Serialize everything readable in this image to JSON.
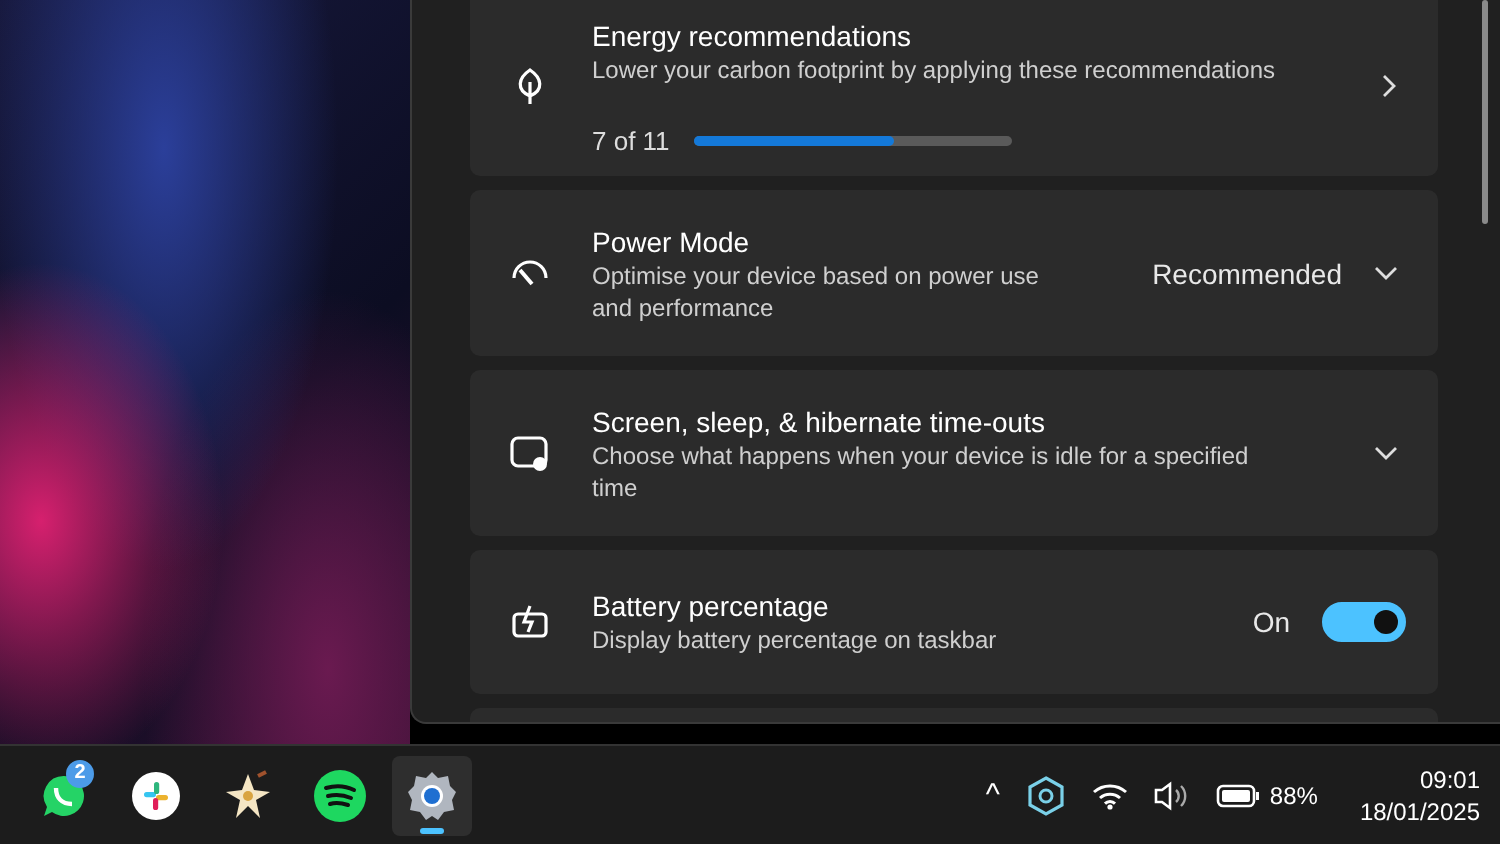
{
  "settings": {
    "cards": [
      {
        "kind": "progress",
        "title": "Energy recommendations",
        "description": "Lower your carbon footprint by applying these recommendations",
        "progress_label": "7 of 11",
        "level": 0.63
      },
      {
        "kind": "dropdown",
        "title": "Power Mode",
        "description": "Optimise your device based on power use and performance",
        "value": "Recommended"
      },
      {
        "kind": "expander",
        "title": "Screen, sleep, & hibernate time-outs",
        "description": "Choose what happens when your device is idle for a specified time"
      },
      {
        "kind": "toggle",
        "title": "Battery percentage",
        "description": "Display battery percentage on taskbar",
        "state_label": "On",
        "on": true
      },
      {
        "kind": "partial"
      }
    ]
  },
  "taskbar": {
    "apps": [
      {
        "badge": "2",
        "selected": false
      },
      {
        "selected": false
      },
      {
        "selected": false
      },
      {
        "selected": false
      },
      {
        "selected": true
      }
    ],
    "tray": {
      "chevron": "^",
      "battery_percent": "88%",
      "time": "09:01",
      "date": "18/01/2025"
    }
  }
}
